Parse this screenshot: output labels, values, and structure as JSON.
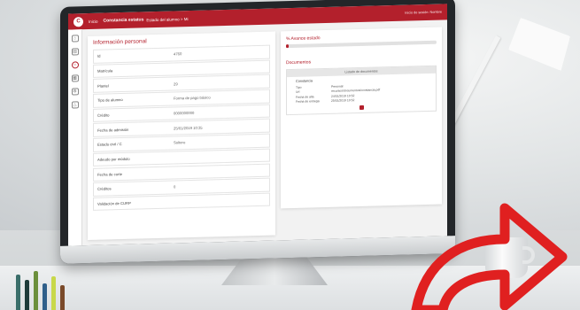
{
  "app": {
    "logo_text": "C",
    "section_prefix": "Inicio",
    "title": "Constancia estatus",
    "subtitle": "Estado del alumno > Mi",
    "user": "Inicio de sesión: Nombre"
  },
  "sidebar": {
    "icons": [
      "home-icon",
      "document-icon",
      "circle-icon",
      "chart-icon",
      "settings-icon",
      "alert-icon"
    ]
  },
  "info_panel": {
    "title": "Información personal",
    "fields": [
      {
        "label": "Id",
        "value": "4760"
      },
      {
        "label": "Matrícula",
        "value": ""
      },
      {
        "label": "Plantel",
        "value": "29"
      },
      {
        "label": "Tipo de alumno",
        "value": "Forma de pago básico"
      },
      {
        "label": "Crédito",
        "value": "0000000000"
      },
      {
        "label": "Fecha de admisión",
        "value": "25/01/2019 10:35"
      },
      {
        "label": "Estado civil / C",
        "value": "Soltero"
      },
      {
        "label": "Adeudo por módulo",
        "value": ""
      },
      {
        "label": "Fecha de corte",
        "value": ""
      },
      {
        "label": "Créditos",
        "value": "0"
      },
      {
        "label": "Validación de CURP",
        "value": ""
      }
    ]
  },
  "right_panel": {
    "progress_title": "% Avance estado",
    "progress": 0.02,
    "docs_title": "Documentos",
    "docs_header": "Listado de documentos",
    "doc_name": "Constancia",
    "doc_rows": [
      {
        "k": "Tipo",
        "v": "Personal"
      },
      {
        "k": "Url",
        "v": "recursos/documentos/constancia.pdf"
      },
      {
        "k": "Fecha de alta",
        "v": "24/01/2019 10:52"
      },
      {
        "k": "Fecha de entrega",
        "v": "25/01/2019 10:52"
      }
    ]
  },
  "colors": {
    "brand": "#b3202c",
    "arrow": "#e02020"
  }
}
